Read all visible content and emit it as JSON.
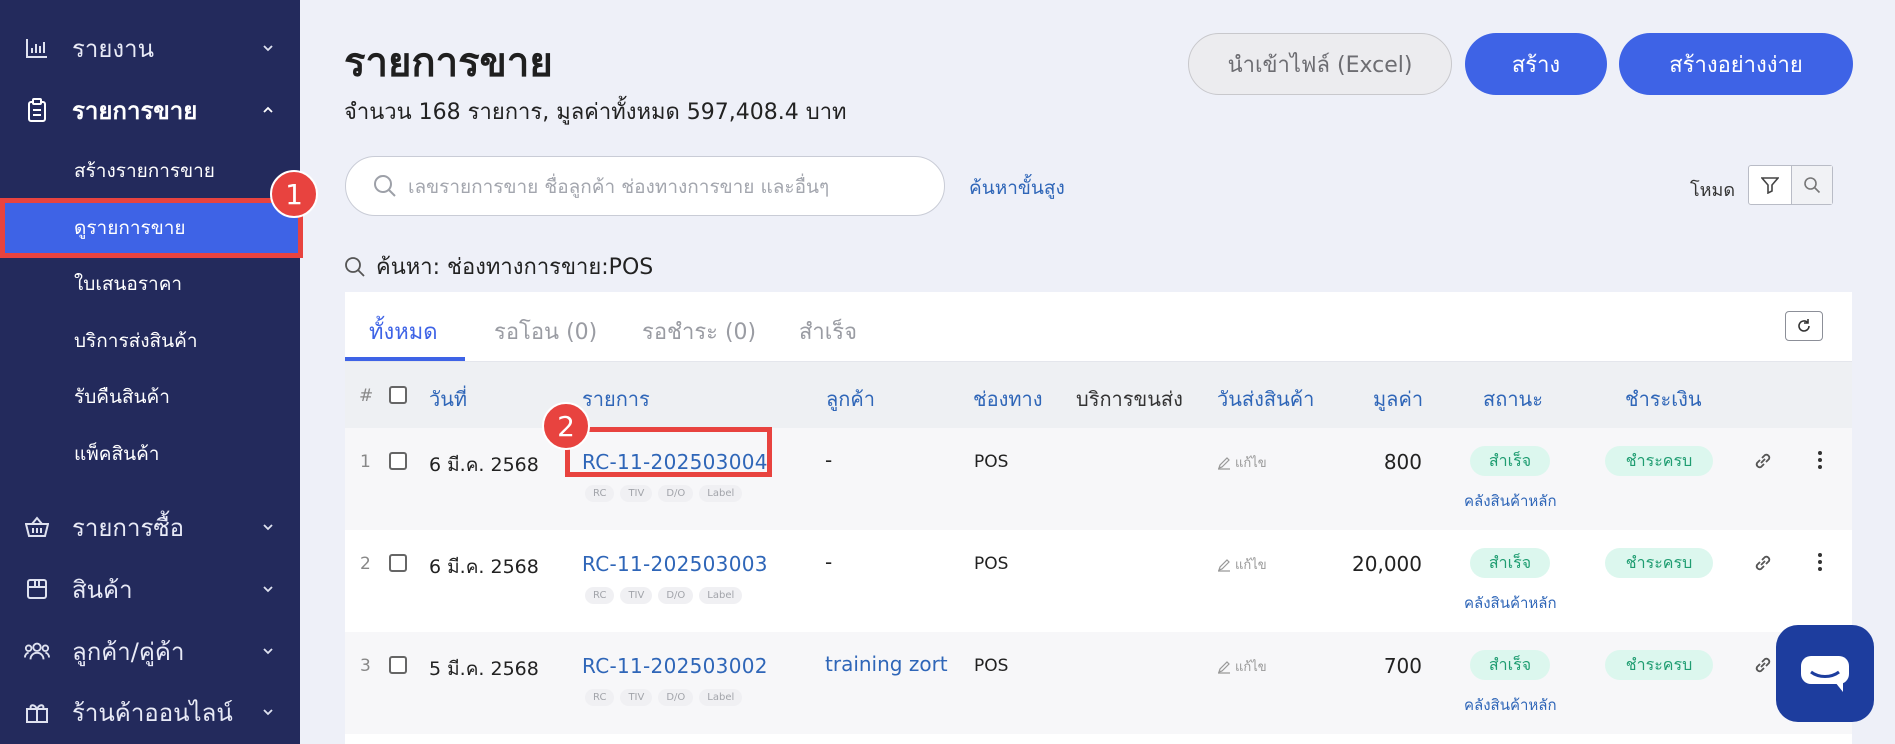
{
  "sidebar": {
    "items": [
      {
        "label": "รายงาน",
        "icon": "bar-chart-icon"
      },
      {
        "label": "รายการขาย",
        "icon": "clipboard-icon"
      },
      {
        "label": "รายการซื้อ",
        "icon": "basket-icon"
      },
      {
        "label": "สินค้า",
        "icon": "box-icon"
      },
      {
        "label": "ลูกค้า/คู่ค้า",
        "icon": "users-icon"
      },
      {
        "label": "ร้านค้าออนไลน์",
        "icon": "gift-icon"
      }
    ],
    "sub_items": [
      {
        "label": "สร้างรายการขาย"
      },
      {
        "label": "ดูรายการขาย"
      },
      {
        "label": "ใบเสนอราคา"
      },
      {
        "label": "บริการส่งสินค้า"
      },
      {
        "label": "รับคืนสินค้า"
      },
      {
        "label": "แพ็คสินค้า"
      }
    ]
  },
  "annotations": {
    "step1": "1",
    "step2": "2"
  },
  "header": {
    "title": "รายการขาย",
    "subtitle": "จำนวน 168 รายการ, มูลค่าทั้งหมด 597,408.4 บาท",
    "import_label": "นำเข้าไฟล์ (Excel)",
    "create_label": "สร้าง",
    "easy_create_label": "สร้างอย่างง่าย"
  },
  "search": {
    "placeholder": "เลขรายการขาย ชื่อลูกค้า ช่องทางการขาย และอื่นๆ",
    "advanced_label": "ค้นหาขั้นสูง",
    "mode_label": "โหมด",
    "active_filter": "ค้นหา: ช่องทางการขาย:POS"
  },
  "tabs": [
    {
      "label": "ทั้งหมด"
    },
    {
      "label": "รอโอน (0)"
    },
    {
      "label": "รอชำระ (0)"
    },
    {
      "label": "สำเร็จ"
    }
  ],
  "table": {
    "headers": {
      "num": "#",
      "date": "วันที่",
      "doc": "รายการ",
      "customer": "ลูกค้า",
      "channel": "ช่องทาง",
      "shipping": "บริการขนส่ง",
      "ship_date": "วันส่งสินค้า",
      "amount": "มูลค่า",
      "status": "สถานะ",
      "payment": "ชำระเงิน"
    },
    "tag_labels": [
      "RC",
      "TIV",
      "D/O",
      "Label"
    ],
    "edit_label": "แก้ไข",
    "rows": [
      {
        "idx": "1",
        "date": "6 มี.ค. 2568",
        "doc": "RC-11-202503004",
        "customer": "-",
        "channel": "POS",
        "amount": "800",
        "status": "สำเร็จ",
        "warehouse": "คลังสินค้าหลัก",
        "payment": "ชำระครบ"
      },
      {
        "idx": "2",
        "date": "6 มี.ค. 2568",
        "doc": "RC-11-202503003",
        "customer": "-",
        "channel": "POS",
        "amount": "20,000",
        "status": "สำเร็จ",
        "warehouse": "คลังสินค้าหลัก",
        "payment": "ชำระครบ"
      },
      {
        "idx": "3",
        "date": "5 มี.ค. 2568",
        "doc": "RC-11-202503002",
        "customer": "training zort",
        "channel": "POS",
        "amount": "700",
        "status": "สำเร็จ",
        "warehouse": "คลังสินค้าหลัก",
        "payment": "ชำระครบ"
      }
    ]
  },
  "colors": {
    "sidebar_bg": "#232a5c",
    "accent": "#3e63e6",
    "highlight": "#e8433f",
    "success_bg": "#dcf7ee",
    "success_text": "#1f9d71"
  }
}
